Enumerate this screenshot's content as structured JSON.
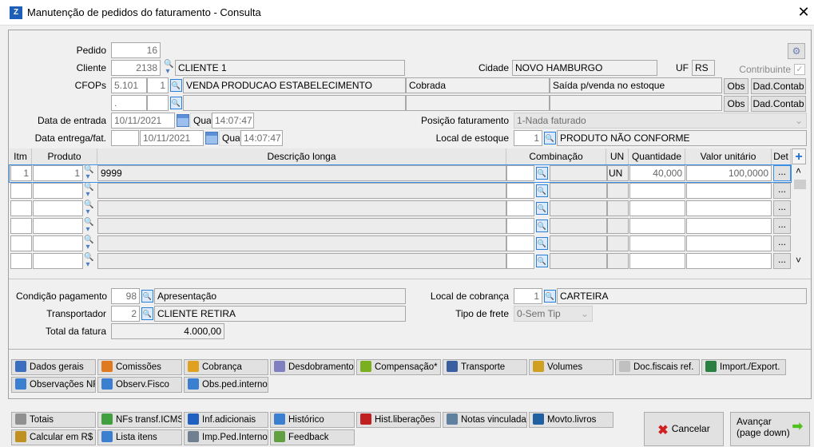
{
  "window": {
    "title": "Manutenção de pedidos do faturamento - Consulta",
    "close": "✕"
  },
  "header": {
    "pedido_label": "Pedido",
    "pedido": "16",
    "cliente_label": "Cliente",
    "cliente_code": "2138",
    "cliente_name": "CLIENTE 1",
    "cidade_label": "Cidade",
    "cidade": "NOVO HAMBURGO",
    "uf_label": "UF",
    "uf": "RS",
    "contribuinte_label": "Contribuinte",
    "contribuinte_checked": true,
    "cfops_label": "CFOPs",
    "cfops": [
      {
        "code": "5.101",
        "seq": "1",
        "desc": "VENDA PRODUCAO ESTABELECIMENTO",
        "tipo": "Cobrada",
        "obs_text": "Saída p/venda no estoque"
      },
      {
        "code": ".",
        "seq": "",
        "desc": "",
        "tipo": "",
        "obs_text": ""
      }
    ],
    "obs_label": "Obs",
    "dadcontab_label": "Dad.Contab",
    "data_entrada_label": "Data de entrada",
    "data_entrada": "10/11/2021",
    "data_entrada_dia": "Qua",
    "data_entrada_hora": "14:07:47",
    "data_entrega_label": "Data entrega/fat.",
    "data_entrega_prefix": "",
    "data_entrega": "10/11/2021",
    "data_entrega_dia": "Qua",
    "data_entrega_hora": "14:07:47",
    "posicao_label": "Posição faturamento",
    "posicao": "1-Nada faturado",
    "local_estoque_label": "Local de estoque",
    "local_estoque_code": "1",
    "local_estoque": "PRODUTO NÃO CONFORME"
  },
  "grid": {
    "columns": [
      "Itm",
      "Produto",
      "Descrição longa",
      "Combinação",
      "UN",
      "Quantidade",
      "Valor unitário",
      "Det",
      "+"
    ],
    "rows": [
      {
        "itm": "1",
        "produto": "1",
        "desc": "9999",
        "comb": "",
        "comb2": "",
        "un": "UN",
        "qtd": "40,000",
        "valor": "100,0000",
        "det": "..."
      },
      {
        "itm": "",
        "produto": "",
        "desc": "",
        "comb": "",
        "comb2": "",
        "un": "",
        "qtd": "",
        "valor": "",
        "det": "..."
      },
      {
        "itm": "",
        "produto": "",
        "desc": "",
        "comb": "",
        "comb2": "",
        "un": "",
        "qtd": "",
        "valor": "",
        "det": "..."
      },
      {
        "itm": "",
        "produto": "",
        "desc": "",
        "comb": "",
        "comb2": "",
        "un": "",
        "qtd": "",
        "valor": "",
        "det": "..."
      },
      {
        "itm": "",
        "produto": "",
        "desc": "",
        "comb": "",
        "comb2": "",
        "un": "",
        "qtd": "",
        "valor": "",
        "det": "..."
      },
      {
        "itm": "",
        "produto": "",
        "desc": "",
        "comb": "",
        "comb2": "",
        "un": "",
        "qtd": "",
        "valor": "",
        "det": "..."
      }
    ],
    "scroll_up": "˄",
    "scroll_down": "˅"
  },
  "footer": {
    "cond_label": "Condição pagamento",
    "cond_code": "98",
    "cond": "Apresentação",
    "transp_label": "Transportador",
    "transp_code": "2",
    "transp": "CLIENTE RETIRA",
    "total_label": "Total da fatura",
    "total": "4.000,00",
    "cobranca_label": "Local de cobrança",
    "cobranca_code": "1",
    "cobranca": "CARTEIRA",
    "frete_label": "Tipo de frete",
    "frete": "0-Sem Tip"
  },
  "tabs": [
    {
      "label": "Dados gerais",
      "icon": "edit-icon",
      "color": "#3a6fc0"
    },
    {
      "label": "Comissões",
      "icon": "person-icon",
      "color": "#e07a20"
    },
    {
      "label": "Cobrança",
      "icon": "billing-icon",
      "color": "#e0a020"
    },
    {
      "label": "Desdobramentos",
      "icon": "clock-doc-icon",
      "color": "#8080c0"
    },
    {
      "label": "Compensação*",
      "icon": "compensation-icon",
      "color": "#7ab020"
    },
    {
      "label": "Transporte",
      "icon": "truck-icon",
      "color": "#3a5fa0"
    },
    {
      "label": "Volumes",
      "icon": "box-icon",
      "color": "#d0a020"
    },
    {
      "label": "Doc.fiscais ref.",
      "icon": "document-icon",
      "color": "#c0c0c0"
    },
    {
      "label": "Import./Export.",
      "icon": "globe-icon",
      "color": "#2a8040"
    },
    {
      "label": "Observações NF",
      "icon": "note-icon",
      "color": "#3a7fd0"
    },
    {
      "label": "Observ.Fisco",
      "icon": "note-icon",
      "color": "#3a7fd0"
    },
    {
      "label": "Obs.ped.interno",
      "icon": "note-icon",
      "color": "#3a7fd0"
    }
  ],
  "actions": [
    {
      "label": "Totais",
      "icon": "list-icon",
      "color": "#909090"
    },
    {
      "label": "NFs transf.ICMS",
      "icon": "transfer-doc-icon",
      "color": "#40a040"
    },
    {
      "label": "Inf.adicionais",
      "icon": "info-icon",
      "color": "#2060c0"
    },
    {
      "label": "Histórico",
      "icon": "history-icon",
      "color": "#3a7fd0"
    },
    {
      "label": "Hist.liberações",
      "icon": "blocked-icon",
      "color": "#c02020"
    },
    {
      "label": "Notas vinculadas",
      "icon": "linked-notes-icon",
      "color": "#6080a0"
    },
    {
      "label": "Movto.livros",
      "icon": "books-icon",
      "color": "#2060a0"
    },
    {
      "label": "Calcular em R$",
      "icon": "money-bag-icon",
      "color": "#c09020"
    },
    {
      "label": "Lista itens",
      "icon": "calculator-icon",
      "color": "#3a7fd0"
    },
    {
      "label": "Imp.Ped.Interno",
      "icon": "printer-icon",
      "color": "#708090"
    },
    {
      "label": "Feedback",
      "icon": "feedback-icon",
      "color": "#60a040"
    }
  ],
  "cancel_label": "Cancelar",
  "next_label_line1": "Avançar",
  "next_label_line2": "(page down)"
}
